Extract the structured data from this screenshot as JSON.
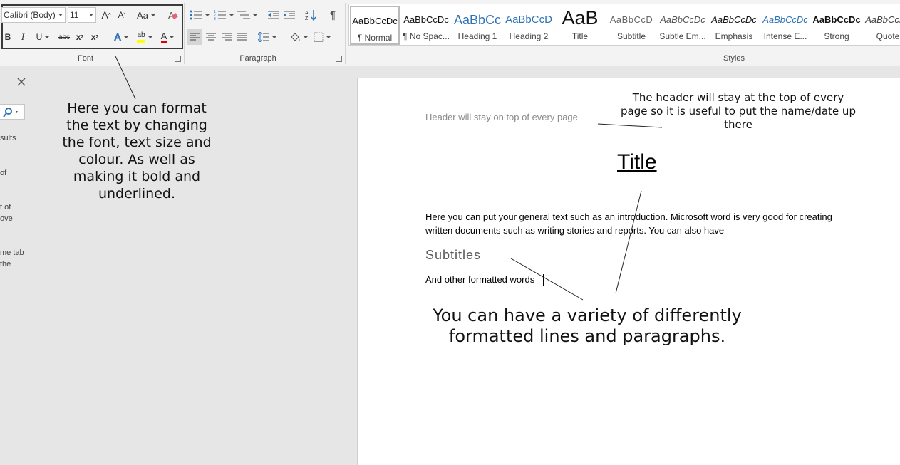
{
  "ribbon": {
    "font": {
      "label": "Font",
      "font_name": "Calibri (Body)",
      "font_size": "11",
      "grow_glyph": "A",
      "shrink_glyph": "A",
      "case_label": "Aa",
      "bold": "B",
      "italic": "I",
      "underline": "U",
      "strike": "abc",
      "subscript": "x",
      "superscript": "x",
      "sub_mark": "2",
      "sup_mark": "2",
      "effects": "A",
      "highlight": "ab",
      "font_color": "A"
    },
    "paragraph": {
      "label": "Paragraph"
    },
    "styles": {
      "label": "Styles",
      "items": [
        {
          "preview": "AaBbCcDc",
          "name": "¶ Normal"
        },
        {
          "preview": "AaBbCcDc",
          "name": "¶ No Spac..."
        },
        {
          "preview": "AaBbCc",
          "name": "Heading 1"
        },
        {
          "preview": "AaBbCcD",
          "name": "Heading 2"
        },
        {
          "preview": "AaB",
          "name": "Title"
        },
        {
          "preview": "AaBbCcD",
          "name": "Subtitle"
        },
        {
          "preview": "AaBbCcDc",
          "name": "Subtle Em..."
        },
        {
          "preview": "AaBbCcDc",
          "name": "Emphasis"
        },
        {
          "preview": "AaBbCcDc",
          "name": "Intense E..."
        },
        {
          "preview": "AaBbCcDc",
          "name": "Strong"
        },
        {
          "preview": "AaBbCcDc",
          "name": "Quote"
        }
      ]
    }
  },
  "nav_pane": {
    "fragments": [
      "sults",
      "of",
      "t of",
      "ove",
      "me tab",
      "the"
    ]
  },
  "document": {
    "header": "Header will stay on top of every page",
    "title": "Title",
    "body_line1": "Here you can put your general text such as an introduction. Microsoft word is very good for creating",
    "body_line2": "written documents such as writing stories and reports. You can also have",
    "subtitle": "Subtitles",
    "other_words": "And other formatted words"
  },
  "annotations": {
    "font_note": [
      "Here you can format",
      "the text by changing",
      "the font, text size and",
      "colour. As well as",
      "making it bold and",
      "underlined."
    ],
    "header_note": [
      "The header will stay at the top of every",
      "page so it is useful to put the name/date up",
      "there"
    ],
    "variety_note": [
      "You can have a variety of differently",
      "formatted lines and paragraphs."
    ]
  },
  "colors": {
    "highlight": "#ffff00",
    "font_color": "#e00000",
    "heading_blue": "#2e74b5"
  },
  "icons": {
    "close": "close-icon",
    "search": "search-icon"
  }
}
